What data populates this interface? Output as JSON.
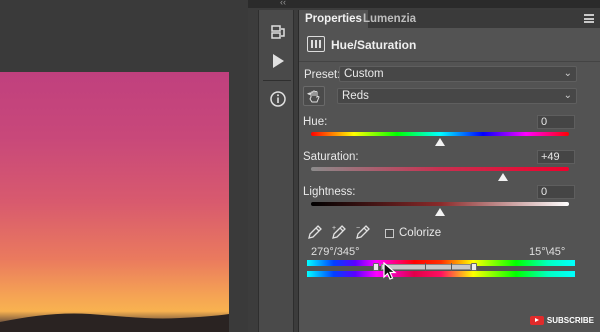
{
  "tabs": [
    {
      "label": "Properties",
      "active": true
    },
    {
      "label": "Lumenzia",
      "active": false
    }
  ],
  "panel": {
    "title": "Hue/Saturation",
    "icon": "hue-saturation-adjustment-icon"
  },
  "preset": {
    "label": "Preset:",
    "value": "Custom"
  },
  "channel": {
    "value": "Reds"
  },
  "hue": {
    "label": "Hue:",
    "value": "0",
    "fraction": 0.5
  },
  "saturation": {
    "label": "Saturation:",
    "value": "+49",
    "fraction": 0.745
  },
  "lightness": {
    "label": "Lightness:",
    "value": "0",
    "fraction": 0.5
  },
  "colorize": {
    "label": "Colorize",
    "checked": false
  },
  "range": {
    "left_label": "279°/345°",
    "right_label": "15°\\45°"
  },
  "toolstrip": {
    "icons": [
      "history-icon",
      "play-icon",
      "info-icon"
    ]
  },
  "watermark": {
    "label": "SUBSCRIBE"
  },
  "colors": {
    "panel_bg": "#535353",
    "thumb": "#f2f2f2",
    "accent_red": "#e12b2b"
  }
}
